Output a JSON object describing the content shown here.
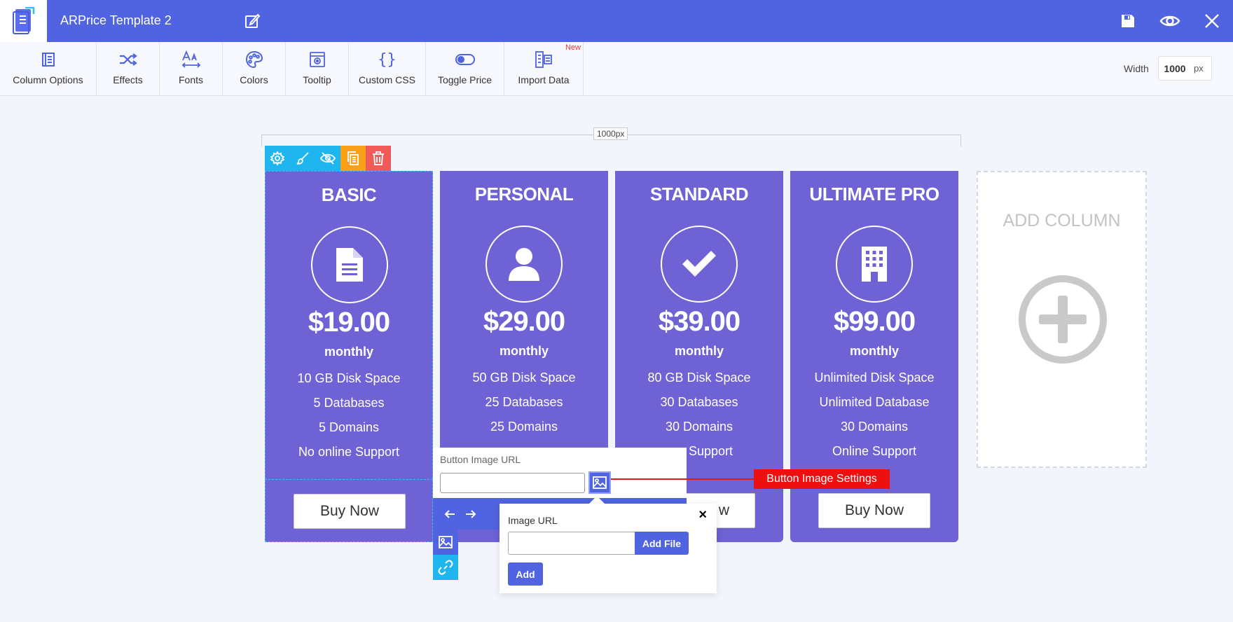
{
  "header": {
    "title": "ARPrice Template 2",
    "icons": [
      "logo-icon",
      "edit-icon",
      "save-icon",
      "preview-eye-icon",
      "close-icon"
    ],
    "background_color": "#5063e0"
  },
  "toolbar": {
    "items": [
      {
        "label": "Column Options",
        "icon": "column-options-icon"
      },
      {
        "label": "Effects",
        "icon": "shuffle-icon"
      },
      {
        "label": "Fonts",
        "icon": "fonts-icon"
      },
      {
        "label": "Colors",
        "icon": "palette-icon"
      },
      {
        "label": "Tooltip",
        "icon": "tooltip-icon"
      },
      {
        "label": "Custom CSS",
        "icon": "braces-icon"
      },
      {
        "label": "Toggle Price",
        "icon": "toggle-icon"
      },
      {
        "label": "Import Data",
        "icon": "import-icon",
        "badge": "New"
      }
    ],
    "width_label": "Width",
    "width_value": "1000",
    "width_unit": "px"
  },
  "canvas": {
    "ruler_label": "1000px",
    "column_actions": [
      "settings-icon",
      "brush-icon",
      "hide-eye-icon",
      "duplicate-icon",
      "delete-icon"
    ],
    "column_color": "#6e62d4",
    "columns": [
      {
        "title": "BASIC",
        "icon": "document-icon",
        "price": "$19.00",
        "period": "monthly",
        "features": [
          "10 GB Disk Space",
          "5 Databases",
          "5 Domains",
          "No online Support"
        ],
        "button": "Buy Now"
      },
      {
        "title": "PERSONAL",
        "icon": "user-icon",
        "price": "$29.00",
        "period": "monthly",
        "features": [
          "50 GB Disk Space",
          "25 Databases",
          "25 Domains"
        ],
        "button": ""
      },
      {
        "title": "STANDARD",
        "icon": "check-icon",
        "price": "$39.00",
        "period": "monthly",
        "features": [
          "80 GB Disk Space",
          "30 Databases",
          "30 Domains",
          "e Support"
        ],
        "button": "w"
      },
      {
        "title": "ULTIMATE PRO",
        "icon": "building-icon",
        "price": "$99.00",
        "period": "monthly",
        "features": [
          "Unlimited Disk Space",
          "Unlimited Database",
          "30 Domains",
          "Online Support"
        ],
        "button": "Buy Now"
      }
    ],
    "add_column_label": "ADD COLUMN"
  },
  "button_image_panel": {
    "label": "Button Image URL",
    "value": ""
  },
  "callout": {
    "text": "Button Image Settings",
    "color": "#ee1010"
  },
  "image_popup": {
    "label": "Image URL",
    "value": "",
    "add_file_label": "Add File",
    "add_label": "Add",
    "close_label": "×"
  }
}
